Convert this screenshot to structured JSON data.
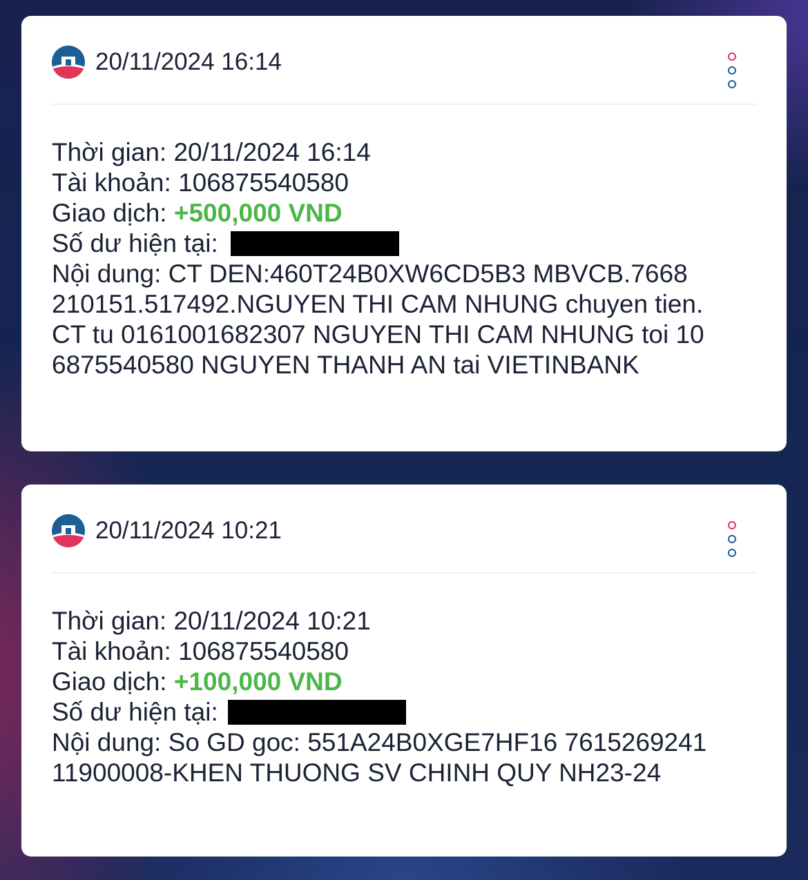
{
  "notifications": [
    {
      "header_time": "20/11/2024 16:14",
      "logo_icon": "vietinbank-logo",
      "menu_icon": "more-vertical-icon",
      "fields": {
        "time_label": "Thời gian:",
        "time_value": "20/11/2024 16:14",
        "account_label": "Tài khoản:",
        "account_value": "106875540580",
        "transaction_label": "Giao dịch:",
        "transaction_value": "+500,000 VND",
        "balance_label": "Số dư hiện tại:",
        "balance_value_redacted": true,
        "content_label": "Nội dung:",
        "content_lines": [
          "CT DEN:460T24B0XW6CD5B3 MBVCB.7668",
          "210151.517492.NGUYEN THI CAM NHUNG chuyen tien.",
          "CT tu 0161001682307 NGUYEN THI CAM NHUNG toi 10",
          "6875540580 NGUYEN THANH AN tai VIETINBANK"
        ]
      }
    },
    {
      "header_time": "20/11/2024 10:21",
      "logo_icon": "vietinbank-logo",
      "menu_icon": "more-vertical-icon",
      "fields": {
        "time_label": "Thời gian:",
        "time_value": "20/11/2024 10:21",
        "account_label": "Tài khoản:",
        "account_value": "106875540580",
        "transaction_label": "Giao dịch:",
        "transaction_value": "+100,000 VND",
        "balance_label": "Số dư hiện tại:",
        "balance_value_redacted": true,
        "content_label": "Nội dung:",
        "content_lines": [
          "So GD goc: 551A24B0XGE7HF16 7615269241",
          "11900008-KHEN THUONG SV CHINH QUY NH23-24"
        ]
      }
    }
  ],
  "colors": {
    "amount_green": "#4cb648",
    "text_dark": "#1b2235",
    "logo_blue": "#1d5e96",
    "logo_red": "#e2345a"
  }
}
